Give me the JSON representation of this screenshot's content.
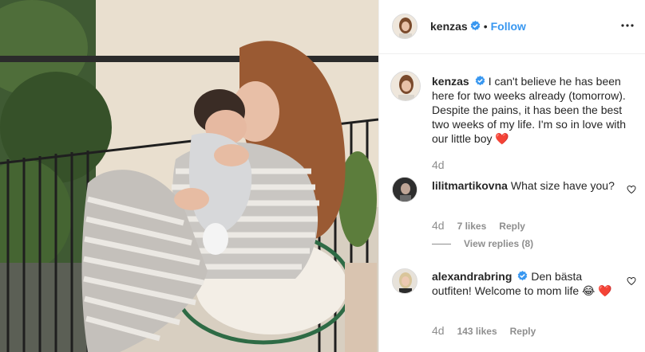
{
  "post": {
    "author": {
      "username": "kenzas",
      "verified": true,
      "follow_label": "Follow",
      "separator": "•"
    },
    "caption": {
      "username": "kenzas",
      "verified": true,
      "text": "I can't believe he has been here for two weeks already (tomorrow). Despite the pains, it has been the best two weeks of my life. I'm so in love with our little boy",
      "emoji": "❤️",
      "time": "4d"
    },
    "comments": [
      {
        "username": "lilitmartikovna",
        "verified": false,
        "text": "What size have you?",
        "time": "4d",
        "likes": "7 likes",
        "reply_label": "Reply",
        "view_replies": "View replies (8)"
      },
      {
        "username": "alexandrabring",
        "verified": true,
        "text": "Den bästa outfiten! Welcome to mom life",
        "emoji_laugh": "😂",
        "emoji_heart": "❤️",
        "time": "4d",
        "likes": "143 likes",
        "reply_label": "Reply"
      }
    ]
  },
  "colors": {
    "link_blue": "#3897f0",
    "verified_blue": "#3897f0",
    "meta_gray": "#8e8e8e",
    "text": "#262626"
  },
  "icons": {
    "more": "more-horizontal-icon",
    "like": "heart-outline-icon",
    "verified": "verified-badge-icon"
  }
}
